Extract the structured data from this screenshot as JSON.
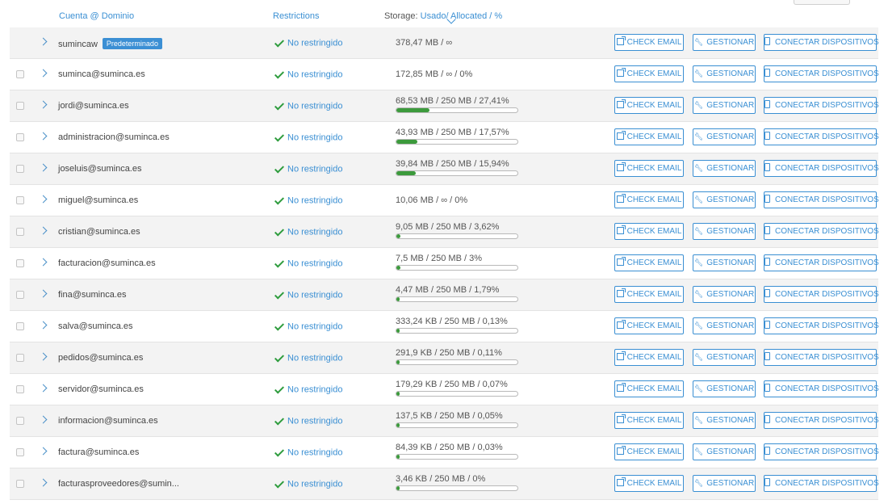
{
  "header": {
    "account_col": "Cuenta @ Dominio",
    "restrictions_col": "Restrictions",
    "storage_prefix": "Storage:",
    "storage_used": "Usado",
    "storage_rest": "/ Allocated / %"
  },
  "buttons": {
    "check_email": "CHECK EMAIL",
    "manage": "GESTIONAR",
    "connect": "CONECTAR DISPOSITIVOS"
  },
  "colors": {
    "accent": "#3a8fd3",
    "ok": "#2e9c3d",
    "bar": "#3c9a3c"
  },
  "rows": [
    {
      "account": "sumincaw",
      "badge": "Predeterminado",
      "restriction": "No restringido",
      "storage": "378,47 MB / ∞",
      "pct": null
    },
    {
      "account": "suminca@suminca.es",
      "restriction": "No restringido",
      "storage": "172,85 MB / ∞ / 0%",
      "pct": null
    },
    {
      "account": "jordi@suminca.es",
      "restriction": "No restringido",
      "storage": "68,53 MB / 250 MB / 27,41%",
      "pct": 27.41
    },
    {
      "account": "administracion@suminca.es",
      "restriction": "No restringido",
      "storage": "43,93 MB / 250 MB / 17,57%",
      "pct": 17.57
    },
    {
      "account": "joseluis@suminca.es",
      "restriction": "No restringido",
      "storage": "39,84 MB / 250 MB / 15,94%",
      "pct": 15.94
    },
    {
      "account": "miguel@suminca.es",
      "restriction": "No restringido",
      "storage": "10,06 MB / ∞ / 0%",
      "pct": null
    },
    {
      "account": "cristian@suminca.es",
      "restriction": "No restringido",
      "storage": "9,05 MB / 250 MB / 3,62%",
      "pct": 3.62
    },
    {
      "account": "facturacion@suminca.es",
      "restriction": "No restringido",
      "storage": "7,5 MB / 250 MB / 3%",
      "pct": 3
    },
    {
      "account": "fina@suminca.es",
      "restriction": "No restringido",
      "storage": "4,47 MB / 250 MB / 1,79%",
      "pct": 1.79
    },
    {
      "account": "salva@suminca.es",
      "restriction": "No restringido",
      "storage": "333,24 KB / 250 MB / 0,13%",
      "pct": 0.13
    },
    {
      "account": "pedidos@suminca.es",
      "restriction": "No restringido",
      "storage": "291,9 KB / 250 MB / 0,11%",
      "pct": 0.11
    },
    {
      "account": "servidor@suminca.es",
      "restriction": "No restringido",
      "storage": "179,29 KB / 250 MB / 0,07%",
      "pct": 0.07
    },
    {
      "account": "informacion@suminca.es",
      "restriction": "No restringido",
      "storage": "137,5 KB / 250 MB / 0,05%",
      "pct": 0.05
    },
    {
      "account": "factura@suminca.es",
      "restriction": "No restringido",
      "storage": "84,39 KB / 250 MB / 0,03%",
      "pct": 0.03
    },
    {
      "account": "facturasproveedores@sumin...",
      "restriction": "No restringido",
      "storage": "3,46 KB / 250 MB / 0%",
      "pct": 0
    }
  ]
}
